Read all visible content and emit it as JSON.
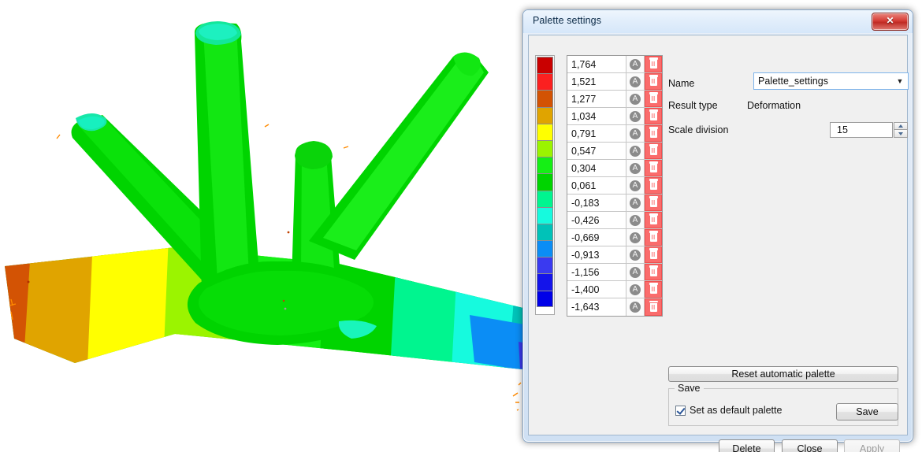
{
  "window": {
    "title": "Palette settings",
    "close_icon": "close-x-icon"
  },
  "palette": {
    "rows": [
      {
        "value": "1,764",
        "color": "#c90000"
      },
      {
        "value": "1,521",
        "color": "#fb2020"
      },
      {
        "value": "1,277",
        "color": "#d35304"
      },
      {
        "value": "1,034",
        "color": "#e0a400"
      },
      {
        "value": "0,791",
        "color": "#ffff00"
      },
      {
        "value": "0,547",
        "color": "#9bf400"
      },
      {
        "value": "0,304",
        "color": "#15ef15"
      },
      {
        "value": "0,061",
        "color": "#00d400"
      },
      {
        "value": "-0,183",
        "color": "#00f58f"
      },
      {
        "value": "-0,426",
        "color": "#16fade"
      },
      {
        "value": "-0,669",
        "color": "#00c2b8"
      },
      {
        "value": "-0,913",
        "color": "#0b8df5"
      },
      {
        "value": "-1,156",
        "color": "#3a3af0"
      },
      {
        "value": "-1,400",
        "color": "#1414ea"
      },
      {
        "value": "-1,643",
        "color": "#0000e8"
      }
    ],
    "row_auto_icon": "auto-circle-a-icon",
    "row_delete_icon": "trash-icon"
  },
  "form": {
    "name_label": "Name",
    "name_value": "Palette_settings",
    "name_dropdown_icon": "chevron-down-icon",
    "result_type_label": "Result type",
    "result_type_value": "Deformation",
    "scale_division_label": "Scale division",
    "scale_division_value": "15",
    "spinner_up_icon": "spinner-up-icon",
    "spinner_down_icon": "spinner-down-icon"
  },
  "actions": {
    "reset_label": "Reset automatic palette",
    "save_group_label": "Save",
    "set_default_label": "Set as default palette",
    "save_label": "Save",
    "delete_label": "Delete",
    "close_label": "Close",
    "apply_label": "Apply"
  },
  "viewport": {
    "model_description": "FEA deformation contour plot of a branched tubular structure",
    "background": "#ffffff"
  },
  "chart_data": {
    "type": "heatmap",
    "title": "Deformation contour legend",
    "categories": [
      "1,764",
      "1,521",
      "1,277",
      "1,034",
      "0,791",
      "0,547",
      "0,304",
      "0,061",
      "-0,183",
      "-0,426",
      "-0,669",
      "-0,913",
      "-1,156",
      "-1,400",
      "-1,643"
    ],
    "values": [
      1.764,
      1.521,
      1.277,
      1.034,
      0.791,
      0.547,
      0.304,
      0.061,
      -0.183,
      -0.426,
      -0.669,
      -0.913,
      -1.156,
      -1.4,
      -1.643
    ],
    "colors": [
      "#c90000",
      "#fb2020",
      "#d35304",
      "#e0a400",
      "#ffff00",
      "#9bf400",
      "#15ef15",
      "#00d400",
      "#00f58f",
      "#16fade",
      "#00c2b8",
      "#0b8df5",
      "#3a3af0",
      "#1414ea",
      "#0000e8"
    ],
    "xlabel": "",
    "ylabel": "Deformation",
    "ylim": [
      -1.643,
      1.764
    ],
    "legend_position": "left"
  }
}
